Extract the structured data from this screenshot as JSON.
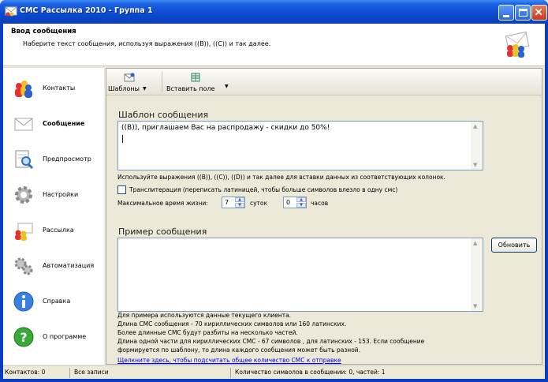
{
  "window": {
    "title": "СМС Рассылка 2010 - Группа 1"
  },
  "header": {
    "title": "Ввод сообщения",
    "subtitle": "Наберите текст сообщения, используя выражения ((В)), ((С)) и так далее."
  },
  "sidebar": {
    "items": [
      {
        "label": "Контакты",
        "icon": "contacts-icon"
      },
      {
        "label": "Сообщение",
        "icon": "envelope-icon",
        "active": true
      },
      {
        "label": "Предпросмотр",
        "icon": "preview-icon"
      },
      {
        "label": "Настройки",
        "icon": "gear-icon"
      },
      {
        "label": "Рассылка",
        "icon": "mailing-icon"
      },
      {
        "label": "Автоматизация",
        "icon": "gears-icon"
      },
      {
        "label": "Справка",
        "icon": "info-icon"
      },
      {
        "label": "О программе",
        "icon": "question-icon"
      }
    ]
  },
  "toolbar": {
    "templates_label": "Шаблоны",
    "insert_field_label": "Вставить поле"
  },
  "template_section": {
    "title": "Шаблон сообщения",
    "message_text": "((В)), приглашаем Вас на распродажу - скидки до 50%!",
    "hint": "Используйте выражения ((В)), ((С)), ((D)) и так далее для вставки данных из соответствующих колонок.",
    "transliteration_label": "Транслитерация (переписать латиницей, чтобы больше символов влезло в одну смс)",
    "transliteration_checked": false,
    "lifetime_label": "Максимальное время жизни:",
    "days_value": "7",
    "days_unit": "суток",
    "hours_value": "0",
    "hours_unit": "часов"
  },
  "example_section": {
    "title": "Пример сообщения",
    "refresh_label": "Обновить",
    "info_lines": [
      "Для примера используются данные текущего клиента.",
      "Длина СМС сообщения - 70 кириллических символов или 160 латинских.",
      "Более длинные СМС будут разбиты на несколько частей.",
      "Длина одной части для кириллических СМС - 67 символов , для латинских - 153. Если сообщение",
      "формируется по шаблону, то длина каждого сообщения может быть разной."
    ],
    "count_link": "Щелкните здесь, чтобы подсчитать общее количество СМС к отправке"
  },
  "statusbar": {
    "contacts": "Контактов: 0",
    "records": "Все записи",
    "chars": "Количество символов в сообщении: 0, частей: 1"
  }
}
